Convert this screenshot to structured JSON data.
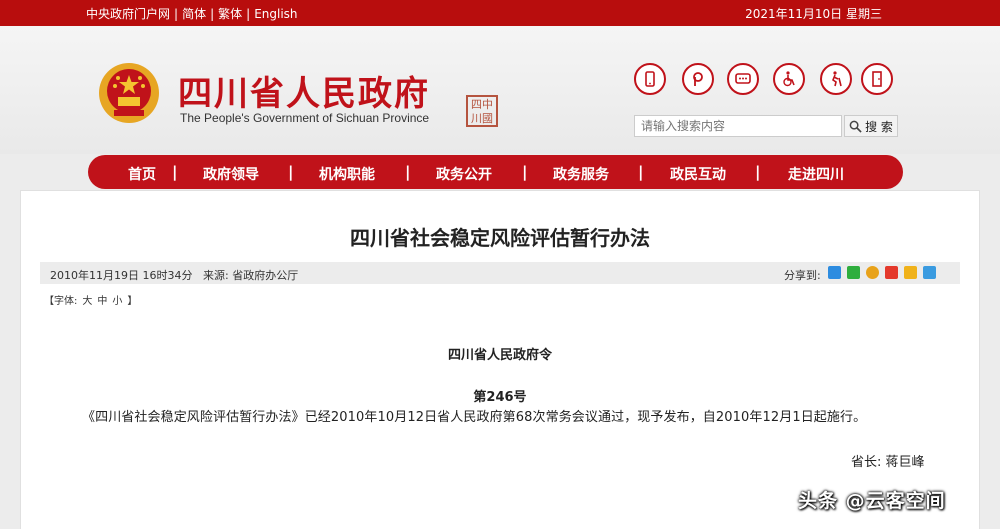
{
  "topbar": {
    "links": [
      "中央政府门户网",
      "简体",
      "繁体",
      "English"
    ],
    "date": "2021年11月10日 星期三"
  },
  "header": {
    "title": "四川省人民政府",
    "subtitle": "The People's Government of Sichuan Province",
    "seal_text": "四中川國"
  },
  "tool_icons": [
    "mobile-icon",
    "weibo-icon",
    "chat-icon",
    "accessibility-icon",
    "elderly-icon",
    "exit-icon"
  ],
  "search": {
    "placeholder": "请输入搜索内容",
    "button_label": "搜 索"
  },
  "nav": {
    "items": [
      "首页",
      "政府领导",
      "机构职能",
      "政务公开",
      "政务服务",
      "政民互动",
      "走进四川"
    ],
    "separator": "|"
  },
  "article": {
    "title": "四川省社会稳定风险评估暂行办法",
    "date": "2010年11月19日 16时34分",
    "source": "来源: 省政府办公厅",
    "share_label": "分享到:",
    "share_icons": [
      "share-plus-icon",
      "wechat-icon",
      "qq-icon",
      "weibo-share-icon",
      "qzone-icon",
      "tencent-icon"
    ],
    "font_size_label": "【字体:",
    "font_sizes": [
      "大",
      "中",
      "小"
    ],
    "font_size_close": "】",
    "decree_issuer": "四川省人民政府令",
    "decree_number": "第246号",
    "body": "《四川省社会稳定风险评估暂行办法》已经2010年10月12日省人民政府第68次常务会议通过，现予发布，自2010年12月1日起施行。",
    "governor": "省长: 蒋巨峰"
  },
  "watermark": "头条 @云客空间",
  "colors": {
    "brand_red": "#c0121a",
    "topbar_red": "#b80d0d"
  }
}
